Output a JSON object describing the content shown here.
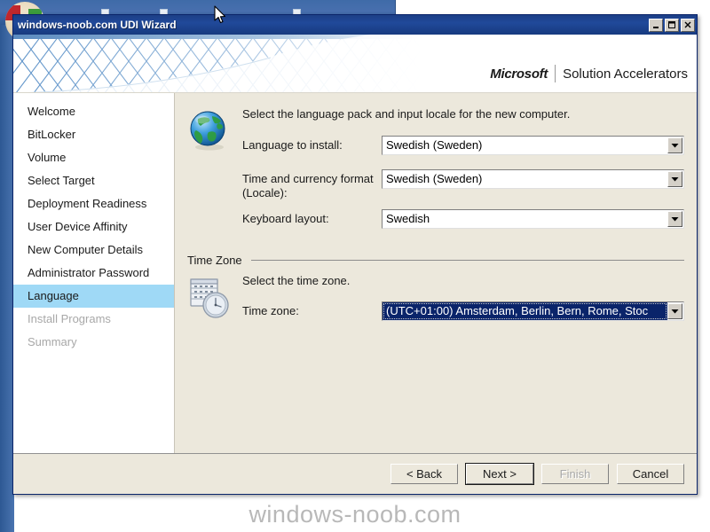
{
  "window": {
    "title": "windows-noob.com UDI Wizard",
    "minimize_label": "minimize",
    "maximize_label": "maximize",
    "close_label": "close"
  },
  "banner": {
    "brand_microsoft": "Microsoft",
    "brand_product": "Solution Accelerators"
  },
  "sidebar": {
    "items": [
      {
        "label": "Welcome",
        "state": "normal"
      },
      {
        "label": "BitLocker",
        "state": "normal"
      },
      {
        "label": "Volume",
        "state": "normal"
      },
      {
        "label": "Select Target",
        "state": "normal"
      },
      {
        "label": "Deployment Readiness",
        "state": "normal"
      },
      {
        "label": "User Device Affinity",
        "state": "normal"
      },
      {
        "label": "New Computer Details",
        "state": "normal"
      },
      {
        "label": "Administrator Password",
        "state": "normal"
      },
      {
        "label": "Language",
        "state": "active"
      },
      {
        "label": "Install Programs",
        "state": "disabled"
      },
      {
        "label": "Summary",
        "state": "disabled"
      }
    ]
  },
  "language_section": {
    "icon": "globe-icon",
    "intro": "Select the language pack and input locale for the new computer.",
    "fields": [
      {
        "label": "Language to install:",
        "label_line2": "",
        "value": "Swedish (Sweden)",
        "focused": false
      },
      {
        "label": "Time and currency format",
        "label_line2": "(Locale):",
        "value": "Swedish (Sweden)",
        "focused": false
      },
      {
        "label": "Keyboard layout:",
        "label_line2": "",
        "value": "Swedish",
        "focused": false
      }
    ]
  },
  "timezone_section": {
    "group_title": "Time Zone",
    "icon": "calendar-clock-icon",
    "intro": "Select the time zone.",
    "field": {
      "label": "Time zone:",
      "value": "(UTC+01:00) Amsterdam, Berlin, Bern, Rome, Stoc",
      "focused": true
    }
  },
  "footer": {
    "back": "< Back",
    "next": "Next >",
    "finish": "Finish",
    "cancel": "Cancel"
  },
  "watermark": {
    "text": "windows-noob.com"
  },
  "colors": {
    "titlebar": "#1c3f87",
    "panel": "#ece8dc",
    "highlight": "#9fd9f6",
    "selection": "#0a246a",
    "disabled_text": "#a8a8a8"
  }
}
